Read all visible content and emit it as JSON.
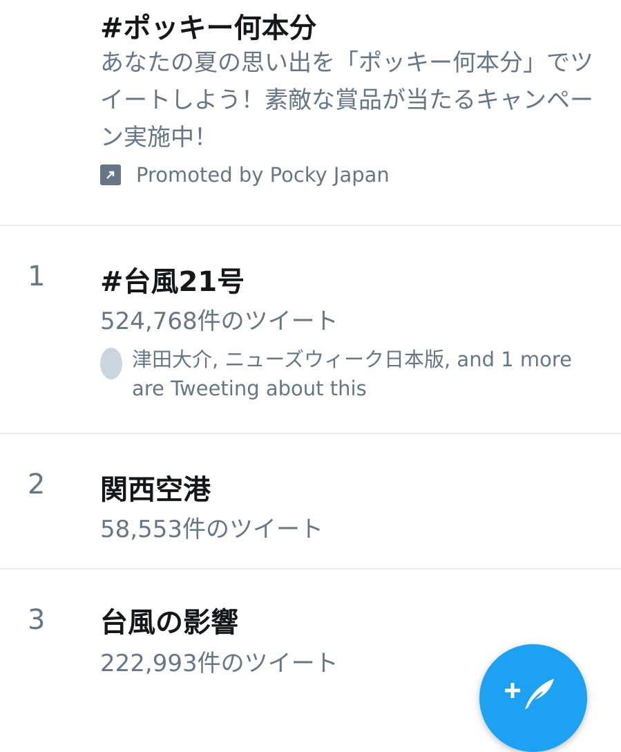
{
  "promoted": {
    "title": "#ポッキー何本分",
    "description": "あなたの夏の思い出を「ポッキー何本分」でツイートしよう！素敵な賞品が当たるキャンペーン実施中！",
    "promoted_by": "Promoted by Pocky Japan",
    "icon": "promoted-arrow-icon"
  },
  "trends": [
    {
      "rank": "1",
      "title": "#台風21号",
      "count": "524,768件のツイート",
      "context": "津田大介, ニューズウィーク日本版, and 1 more are Tweeting about this"
    },
    {
      "rank": "2",
      "title": "関西空港",
      "count": "58,553件のツイート"
    },
    {
      "rank": "3",
      "title": "台風の影響",
      "count": "222,993件のツイート"
    }
  ],
  "compose_button": {
    "icon": "compose-tweet-icon",
    "color": "#1da1f2"
  }
}
